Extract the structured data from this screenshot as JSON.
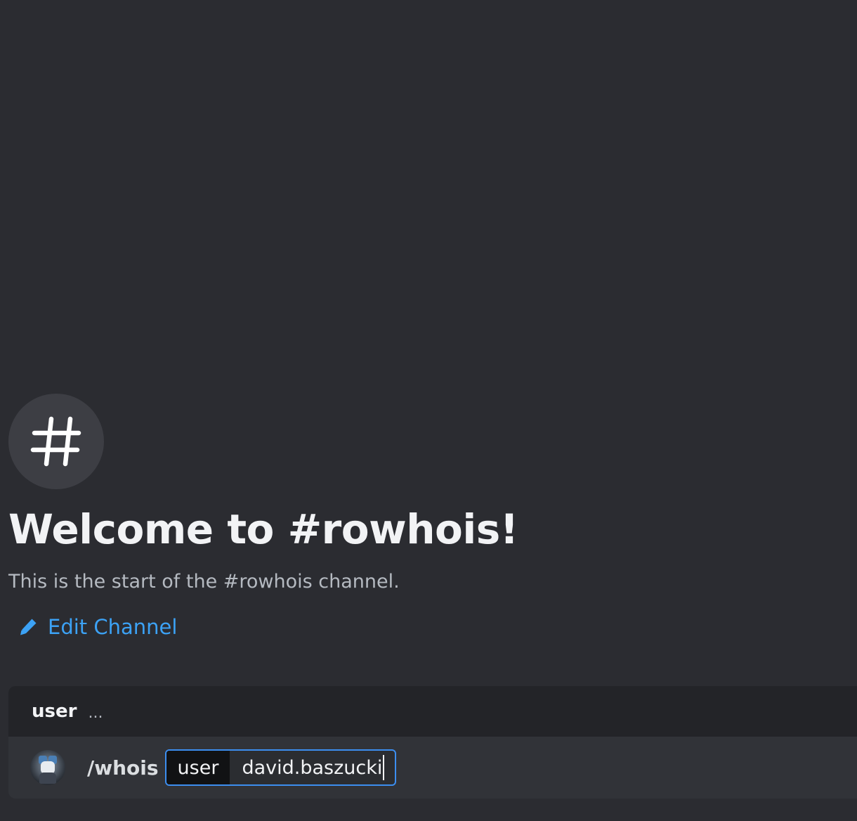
{
  "welcome": {
    "icon": "hash-icon",
    "title": "Welcome to #rowhois!",
    "description": "This is the start of the #rowhois channel.",
    "edit_channel_label": "Edit Channel",
    "edit_icon": "pencil-icon"
  },
  "command_options": {
    "option_name": "user",
    "ellipsis": "..."
  },
  "command_input": {
    "command": "/whois",
    "option_label": "user",
    "option_value": "david.baszucki"
  },
  "colors": {
    "background": "#2b2c31",
    "accent_link": "#3ca2f5",
    "input_focus_border": "#3c8ef0"
  }
}
